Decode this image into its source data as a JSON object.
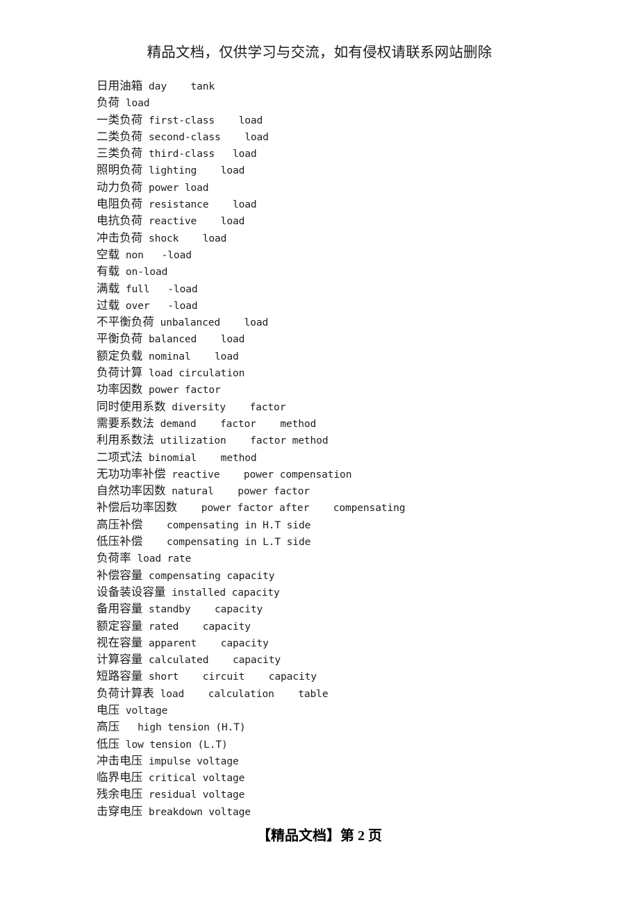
{
  "document": {
    "header_note": "精品文档，仅供学习与交流，如有侵权请联系网站删除",
    "footer": "【精品文档】第 2 页",
    "page_number": "2",
    "text_color": "#1c1c1c",
    "background_color": "#ffffff"
  },
  "entries": [
    {
      "zh": "日用油箱",
      "en": " day    tank"
    },
    {
      "zh": "负荷",
      "en": " load"
    },
    {
      "zh": "一类负荷",
      "en": " first-class    load"
    },
    {
      "zh": "二类负荷",
      "en": " second-class    load"
    },
    {
      "zh": "三类负荷",
      "en": " third-class   load"
    },
    {
      "zh": "照明负荷",
      "en": " lighting    load"
    },
    {
      "zh": "动力负荷",
      "en": " power load"
    },
    {
      "zh": "电阻负荷",
      "en": " resistance    load"
    },
    {
      "zh": "电抗负荷",
      "en": " reactive    load"
    },
    {
      "zh": "冲击负荷",
      "en": " shock    load"
    },
    {
      "zh": "空载",
      "en": " non   -load"
    },
    {
      "zh": "有载",
      "en": " on-load"
    },
    {
      "zh": "满载",
      "en": " full   -load"
    },
    {
      "zh": "过载",
      "en": " over   -load"
    },
    {
      "zh": "不平衡负荷",
      "en": " unbalanced    load"
    },
    {
      "zh": "平衡负荷",
      "en": " balanced    load"
    },
    {
      "zh": "额定负载",
      "en": " nominal    load"
    },
    {
      "zh": "负荷计算",
      "en": " load circulation"
    },
    {
      "zh": "功率因数",
      "en": " power factor"
    },
    {
      "zh": "同时使用系数",
      "en": " diversity    factor"
    },
    {
      "zh": "需要系数法",
      "en": " demand    factor    method"
    },
    {
      "zh": "利用系数法",
      "en": " utilization    factor method"
    },
    {
      "zh": "二项式法",
      "en": " binomial    method"
    },
    {
      "zh": "无功功率补偿",
      "en": " reactive    power compensation"
    },
    {
      "zh": "自然功率因数",
      "en": " natural    power factor"
    },
    {
      "zh": "补偿后功率因数",
      "en": "    power factor after    compensating"
    },
    {
      "zh": "高压补偿",
      "en": "    compensating in H.T side"
    },
    {
      "zh": "低压补偿",
      "en": "    compensating in L.T side"
    },
    {
      "zh": "负荷率",
      "en": " load rate"
    },
    {
      "zh": "补偿容量",
      "en": " compensating capacity"
    },
    {
      "zh": "设备装设容量",
      "en": " installed capacity"
    },
    {
      "zh": "备用容量",
      "en": " standby    capacity"
    },
    {
      "zh": "额定容量",
      "en": " rated    capacity"
    },
    {
      "zh": "视在容量",
      "en": " apparent    capacity"
    },
    {
      "zh": "计算容量",
      "en": " calculated    capacity"
    },
    {
      "zh": "短路容量",
      "en": " short    circuit    capacity"
    },
    {
      "zh": "负荷计算表",
      "en": " load    calculation    table"
    },
    {
      "zh": "电压",
      "en": " voltage"
    },
    {
      "zh": "高压",
      "en": "   high tension (H.T)"
    },
    {
      "zh": "低压",
      "en": " low tension (L.T)"
    },
    {
      "zh": "冲击电压",
      "en": " impulse voltage"
    },
    {
      "zh": "临界电压",
      "en": " critical voltage"
    },
    {
      "zh": "残余电压",
      "en": " residual voltage"
    },
    {
      "zh": "击穿电压",
      "en": " breakdown voltage"
    }
  ]
}
